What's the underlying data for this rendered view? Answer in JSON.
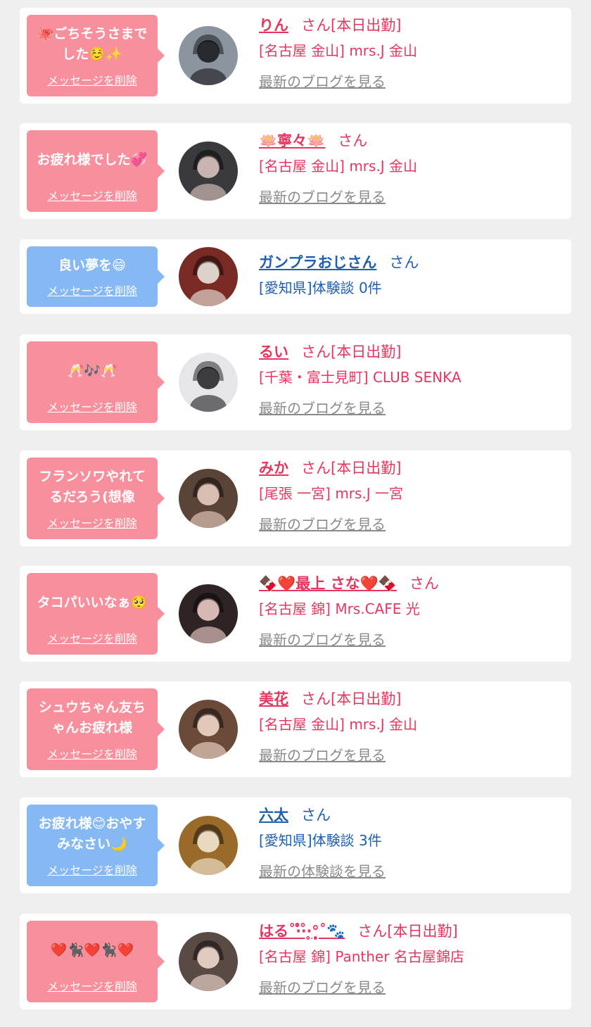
{
  "cards": [
    {
      "theme": "pink",
      "bubble_lines": [
        "🐙ごちそうさまで",
        "した☺️✨"
      ],
      "delete_label": "メッセージを削除",
      "name": "りん",
      "suffix": "さん[本日出勤]",
      "shop": "[名古屋 金山] mrs.J 金山",
      "link": "最新のブログを見る",
      "avatar": {
        "bg": "#8a95a0",
        "accent": "#1e1e22"
      }
    },
    {
      "theme": "pink",
      "bubble_lines": [
        "お疲れ様でした💞"
      ],
      "delete_label": "メッセージを削除",
      "name": "🪷寧々🪷",
      "suffix": "さん",
      "shop": "[名古屋 金山] mrs.J 金山",
      "link": "最新のブログを見る",
      "avatar": {
        "bg": "#3a3a3e",
        "accent": "#d9c2bd"
      }
    },
    {
      "theme": "blue",
      "bubble_lines": [
        "良い夢を😄"
      ],
      "delete_label": "メッセージを削除",
      "name": "ガンプラおじさん",
      "suffix": "さん",
      "shop": "[愛知県]体験談 0件",
      "link": "",
      "avatar": {
        "bg": "#7a2a24",
        "accent": "#e8e4dc"
      }
    },
    {
      "theme": "pink",
      "bubble_lines": [
        "🥂🎶🥂"
      ],
      "delete_label": "メッセージを削除",
      "name": "るい",
      "suffix": "さん[本日出勤]",
      "shop": "[千葉・富士見町] CLUB SENKA",
      "link": "最新のブログを見る",
      "avatar": {
        "bg": "#e6e6ea",
        "accent": "#2a2a2e"
      }
    },
    {
      "theme": "pink",
      "bubble_lines": [
        "フランソワやれて",
        "るだろう(想像"
      ],
      "delete_label": "メッセージを削除",
      "name": "みか",
      "suffix": "さん[本日出勤]",
      "shop": "[尾張 一宮] mrs.J 一宮",
      "link": "最新のブログを見る",
      "avatar": {
        "bg": "#5a4438",
        "accent": "#e7cdbf"
      }
    },
    {
      "theme": "pink",
      "bubble_lines": [
        "タコパいいなぁ🥺"
      ],
      "delete_label": "メッセージを削除",
      "name": "🍫❤️最上 さな❤️🍫",
      "suffix": "さん",
      "shop": "[名古屋 錦] Mrs.CAFE 光",
      "link": "最新のブログを見る",
      "avatar": {
        "bg": "#2f2424",
        "accent": "#e9c9c4"
      }
    },
    {
      "theme": "pink",
      "bubble_lines": [
        "シュウちゃん友ち",
        "ゃんお疲れ様"
      ],
      "delete_label": "メッセージを削除",
      "name": "美花",
      "suffix": "さん[本日出勤]",
      "shop": "[名古屋 金山] mrs.J 金山",
      "link": "最新のブログを見る",
      "avatar": {
        "bg": "#6b4a3a",
        "accent": "#f0d6c6"
      }
    },
    {
      "theme": "blue",
      "bubble_lines": [
        "お疲れ様😊おやす",
        "みなさい🌙"
      ],
      "delete_label": "メッセージを削除",
      "name": "六太",
      "suffix": "さん",
      "shop": "[愛知県]体験談 3件",
      "link": "最新の体験談を見る",
      "avatar": {
        "bg": "#9a6a2a",
        "accent": "#f2e6d2"
      }
    },
    {
      "theme": "pink",
      "bubble_lines": [
        "❤️🐈‍⬛❤️🐈‍⬛❤️"
      ],
      "delete_label": "メッセージを削除",
      "name": "はる˚‧̍̊·̊‧̥°̩̥˚🐾",
      "suffix": "さん[本日出勤]",
      "shop": "[名古屋 錦] Panther 名古屋錦店",
      "link": "最新のブログを見る",
      "avatar": {
        "bg": "#5a4a44",
        "accent": "#efd9cf"
      }
    }
  ],
  "colors": {
    "pink_text": "#e4375f",
    "blue_text": "#1f5fb0",
    "pink_bubble": "#f78f9d",
    "blue_bubble": "#86b8f4",
    "link_gray": "#8a8a8a"
  }
}
